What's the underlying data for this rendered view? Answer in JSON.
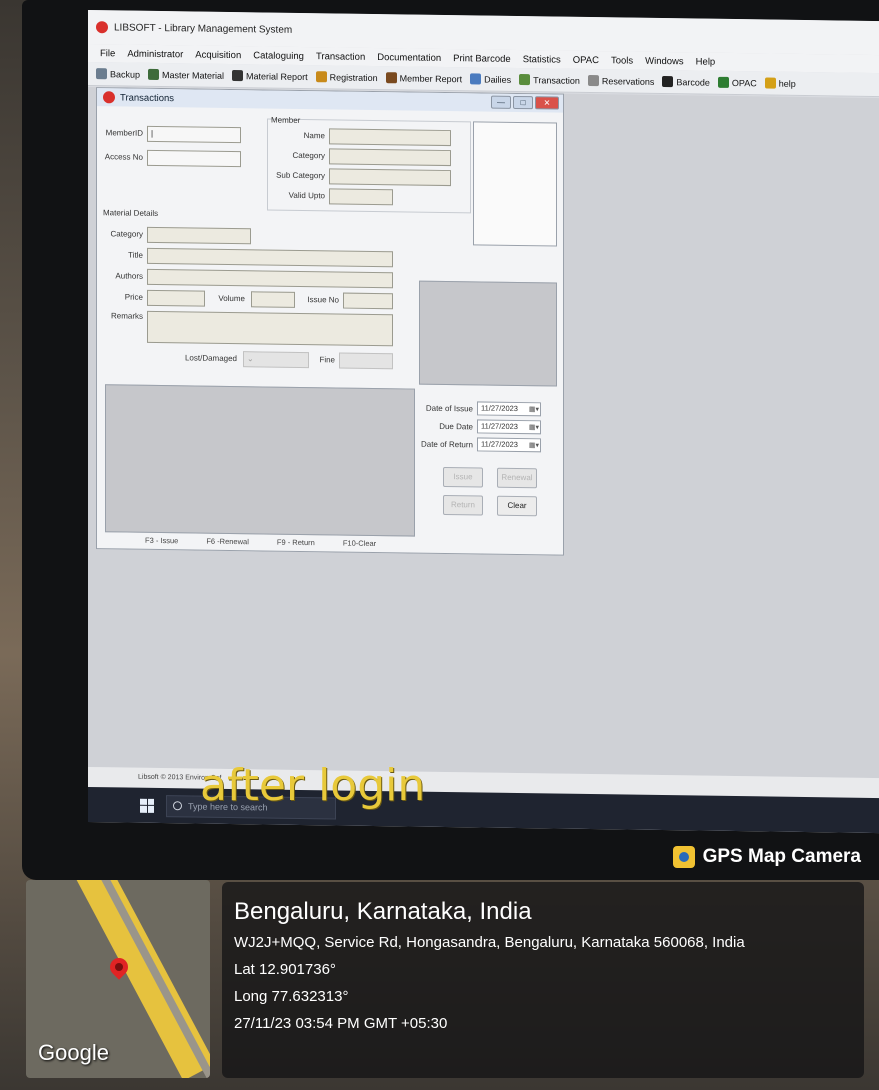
{
  "app": {
    "title": "LIBSOFT - Library Management System",
    "menu": [
      "File",
      "Administrator",
      "Acquisition",
      "Cataloguing",
      "Transaction",
      "Documentation",
      "Print Barcode",
      "Statistics",
      "OPAC",
      "Tools",
      "Windows",
      "Help"
    ],
    "toolbar": [
      {
        "label": "Backup",
        "icon": "backup-icon",
        "color": "#6b7d8f"
      },
      {
        "label": "Master Material",
        "icon": "master-material-icon",
        "color": "#3d6b3a"
      },
      {
        "label": "Material Report",
        "icon": "binoculars-icon",
        "color": "#333333"
      },
      {
        "label": "Registration",
        "icon": "registration-icon",
        "color": "#c88a1a"
      },
      {
        "label": "Member Report",
        "icon": "members-icon",
        "color": "#7a4a1f"
      },
      {
        "label": "Dailies",
        "icon": "dailies-icon",
        "color": "#4a7bbf"
      },
      {
        "label": "Transaction",
        "icon": "transaction-icon",
        "color": "#5a8d3d"
      },
      {
        "label": "Reservations",
        "icon": "reservations-icon",
        "color": "#8a8a8a"
      },
      {
        "label": "Barcode",
        "icon": "barcode-icon",
        "color": "#222222"
      },
      {
        "label": "OPAC",
        "icon": "opac-icon",
        "color": "#2e7d32"
      },
      {
        "label": "help",
        "icon": "help-icon",
        "color": "#d4a017"
      }
    ],
    "status_text": "Libsoft © 2013  Environ Sof"
  },
  "transactions": {
    "title": "Transactions",
    "member_section": "Member",
    "member_id_label": "MemberID",
    "member_id_value": "|",
    "access_no_label": "Access No",
    "name_label": "Name",
    "category_label": "Category",
    "sub_category_label": "Sub Category",
    "valid_upto_label": "Valid Upto",
    "material_section": "Material Details",
    "mat_category_label": "Category",
    "title_label": "Title",
    "authors_label": "Authors",
    "price_label": "Price",
    "volume_label": "Volume",
    "issue_no_label": "Issue No",
    "remarks_label": "Remarks",
    "lost_damaged_label": "Lost/Damaged",
    "fine_label": "Fine",
    "date_of_issue_label": "Date of Issue",
    "date_of_issue_value": "11/27/2023",
    "due_date_label": "Due Date",
    "due_date_value": "11/27/2023",
    "date_of_return_label": "Date of Return",
    "date_of_return_value": "11/27/2023",
    "issue_button": "Issue",
    "renewal_button": "Renewal",
    "return_button": "Return",
    "clear_button": "Clear",
    "shortcuts": [
      "F3 - Issue",
      "F6 -Renewal",
      "F9 - Return",
      "F10-Clear"
    ]
  },
  "taskbar": {
    "search_placeholder": "Type here to search"
  },
  "caption": "after login",
  "gps": {
    "badge": "GPS Map Camera",
    "city": "Bengaluru, Karnataka, India",
    "address": "WJ2J+MQQ, Service Rd, Hongasandra, Bengaluru, Karnataka 560068, India",
    "lat": "Lat 12.901736°",
    "long": "Long 77.632313°",
    "datetime": "27/11/23 03:54 PM GMT +05:30",
    "map_brand": "Google"
  }
}
